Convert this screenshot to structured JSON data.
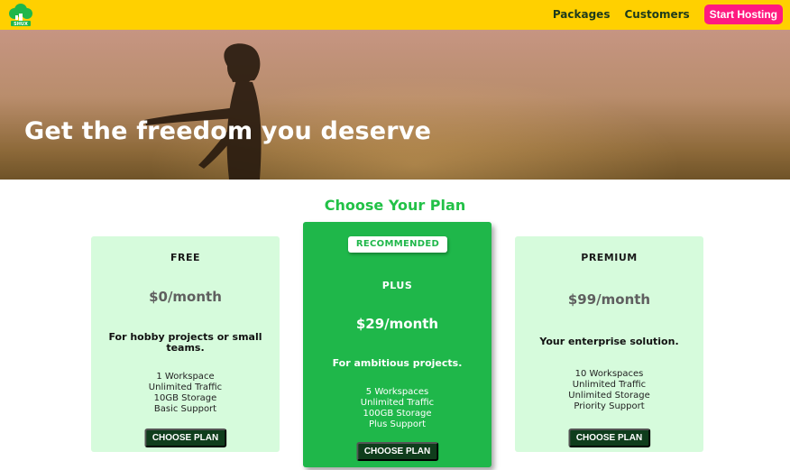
{
  "header": {
    "logo_text": "SHUX",
    "nav": [
      {
        "label": "Packages"
      },
      {
        "label": "Customers"
      }
    ],
    "cta_label": "Start Hosting"
  },
  "hero": {
    "title": "Get the freedom you deserve"
  },
  "plans_section": {
    "title": "Choose Your Plan"
  },
  "plans": [
    {
      "name": "FREE",
      "price": "$0/month",
      "tagline": "For hobby projects or small teams.",
      "features": [
        "1 Workspace",
        "Unlimited Traffic",
        "10GB Storage",
        "Basic Support"
      ],
      "button": "CHOOSE PLAN"
    },
    {
      "badge": "RECOMMENDED",
      "name": "PLUS",
      "price": "$29/month",
      "tagline": "For ambitious projects.",
      "features": [
        "5 Workspaces",
        "Unlimited Traffic",
        "100GB Storage",
        "Plus Support"
      ],
      "button": "CHOOSE PLAN"
    },
    {
      "name": "PREMIUM",
      "price": "$99/month",
      "tagline": "Your enterprise solution.",
      "features": [
        "10 Workspaces",
        "Unlimited Traffic",
        "Unlimited Storage",
        "Priority Support"
      ],
      "button": "CHOOSE PLAN"
    }
  ],
  "colors": {
    "header_bg": "#ffd000",
    "cta_bg": "#ff1a80",
    "accent_green": "#22c147",
    "card_bg": "#d6fbdc",
    "plus_bg": "#1fb74a",
    "button_bg": "#0f3d1c"
  }
}
